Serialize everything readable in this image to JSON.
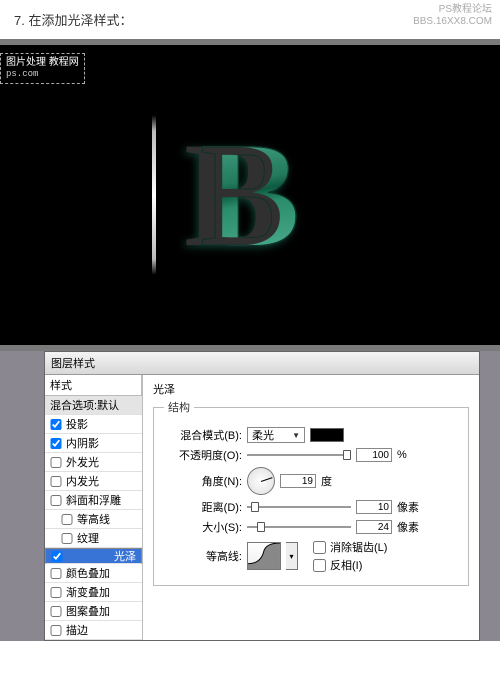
{
  "watermark": {
    "line1": "PS教程论坛",
    "line2": "BBS.16XX8.COM"
  },
  "step": "7. 在添加光泽样式：",
  "tag": {
    "line1": "图片处理 教程网",
    "line2": "ps.com"
  },
  "letter": "B",
  "dialog": {
    "title": "图层样式",
    "styles_header": "样式",
    "blend_header": "混合选项:默认",
    "items": [
      {
        "label": "投影",
        "checked": true
      },
      {
        "label": "内阴影",
        "checked": true
      },
      {
        "label": "外发光",
        "checked": false
      },
      {
        "label": "内发光",
        "checked": false
      },
      {
        "label": "斜面和浮雕",
        "checked": false
      },
      {
        "label": "等高线",
        "checked": false,
        "indent": true
      },
      {
        "label": "纹理",
        "checked": false,
        "indent": true
      },
      {
        "label": "光泽",
        "checked": true,
        "selected": true
      },
      {
        "label": "颜色叠加",
        "checked": false
      },
      {
        "label": "渐变叠加",
        "checked": false
      },
      {
        "label": "图案叠加",
        "checked": false
      },
      {
        "label": "描边",
        "checked": false
      }
    ],
    "panel": {
      "title": "光泽",
      "group": "结构",
      "blend_label": "混合模式(B):",
      "blend_value": "柔光",
      "opacity_label": "不透明度(O):",
      "opacity_value": "100",
      "opacity_unit": "%",
      "angle_label": "角度(N):",
      "angle_value": "19",
      "angle_unit": "度",
      "distance_label": "距离(D):",
      "distance_value": "10",
      "distance_unit": "像素",
      "size_label": "大小(S):",
      "size_value": "24",
      "size_unit": "像素",
      "contour_label": "等高线:",
      "anti_alias": "消除锯齿(L)",
      "invert": "反相(I)"
    }
  }
}
